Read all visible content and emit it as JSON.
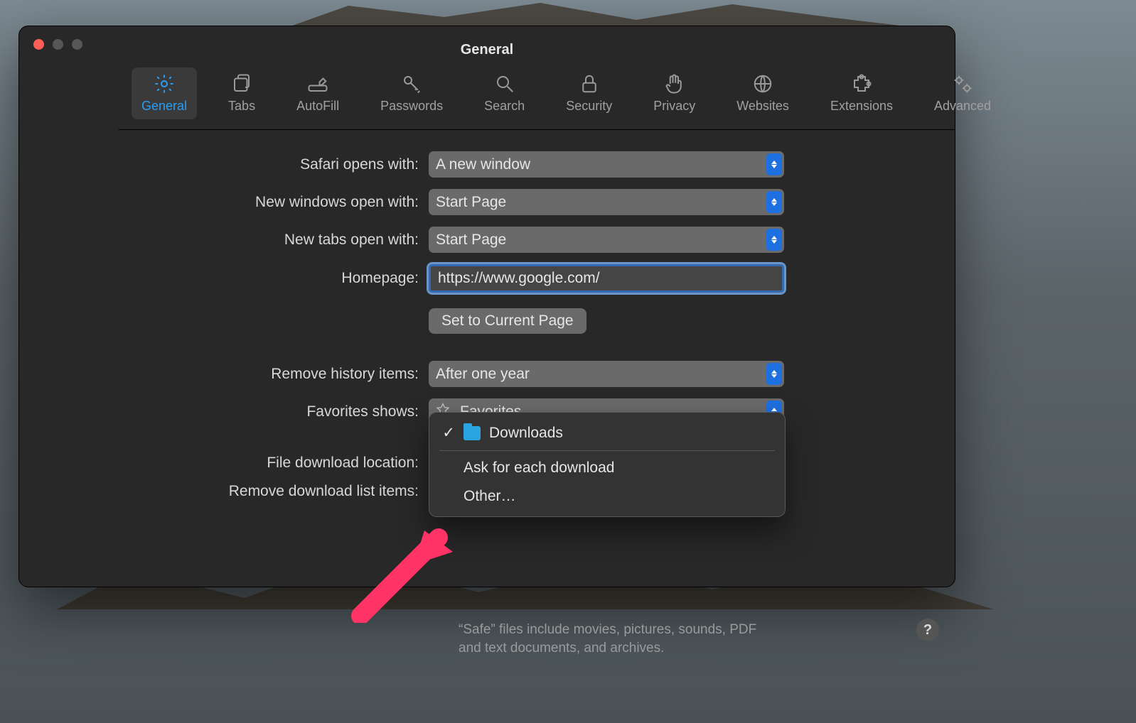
{
  "window": {
    "title": "General"
  },
  "tabs": [
    {
      "label": "General"
    },
    {
      "label": "Tabs"
    },
    {
      "label": "AutoFill"
    },
    {
      "label": "Passwords"
    },
    {
      "label": "Search"
    },
    {
      "label": "Security"
    },
    {
      "label": "Privacy"
    },
    {
      "label": "Websites"
    },
    {
      "label": "Extensions"
    },
    {
      "label": "Advanced"
    }
  ],
  "rows": {
    "opens_with": {
      "label": "Safari opens with:",
      "value": "A new window"
    },
    "new_windows": {
      "label": "New windows open with:",
      "value": "Start Page"
    },
    "new_tabs": {
      "label": "New tabs open with:",
      "value": "Start Page"
    },
    "homepage": {
      "label": "Homepage:",
      "value": "https://www.google.com/"
    },
    "set_current": "Set to Current Page",
    "remove_history": {
      "label": "Remove history items:",
      "value": "After one year"
    },
    "favorites": {
      "label": "Favorites shows:",
      "value": "Favorites"
    },
    "download_loc": {
      "label": "File download location:"
    },
    "remove_downloads": {
      "label": "Remove download list items:"
    }
  },
  "dropdown": {
    "selected": "Downloads",
    "ask": "Ask for each download",
    "other": "Other…"
  },
  "help_text": "“Safe” files include movies, pictures, sounds, PDF and text documents, and archives."
}
